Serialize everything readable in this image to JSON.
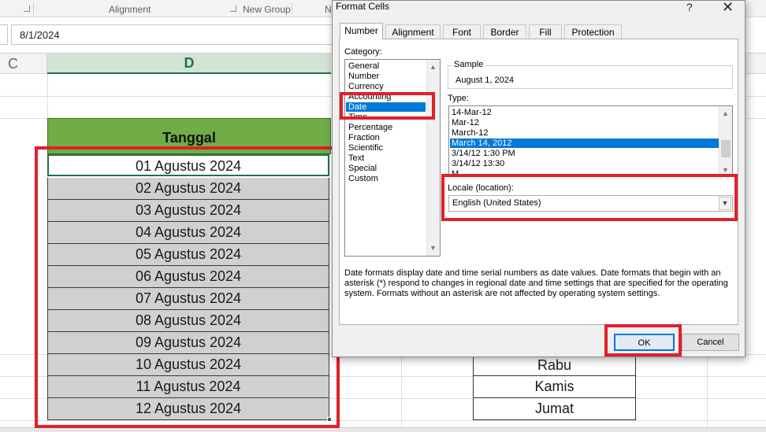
{
  "ribbon": {
    "groups": [
      "Alignment",
      "New Group",
      "N"
    ]
  },
  "formula_bar": {
    "value": "8/1/2024"
  },
  "sheet": {
    "col_c": "C",
    "col_d": "D",
    "header": "Tanggal",
    "dates": [
      "01 Agustus 2024",
      "02 Agustus 2024",
      "03 Agustus 2024",
      "04 Agustus 2024",
      "05 Agustus 2024",
      "06 Agustus 2024",
      "07 Agustus 2024",
      "08 Agustus 2024",
      "09 Agustus 2024",
      "10 Agustus 2024",
      "11 Agustus 2024",
      "12 Agustus 2024"
    ],
    "days": [
      "Rabu",
      "Kamis",
      "Jumat"
    ]
  },
  "dialog": {
    "title": "Format Cells",
    "help": "?",
    "close": "✕",
    "tabs": [
      "Number",
      "Alignment",
      "Font",
      "Border",
      "Fill",
      "Protection"
    ],
    "active_tab": "Number",
    "category_label": "Category:",
    "categories": [
      "General",
      "Number",
      "Currency",
      "Accounting",
      "Date",
      "Time",
      "Percentage",
      "Fraction",
      "Scientific",
      "Text",
      "Special",
      "Custom"
    ],
    "selected_category": "Date",
    "sample_label": "Sample",
    "sample_value": "August 1, 2024",
    "type_label": "Type:",
    "types": [
      "14-Mar-12",
      "Mar-12",
      "March-12",
      "March 14, 2012",
      "3/14/12 1:30 PM",
      "3/14/12 13:30",
      "M"
    ],
    "selected_type": "March 14, 2012",
    "locale_label": "Locale (location):",
    "locale_value": "English (United States)",
    "description": "Date formats display date and time serial numbers as date values.  Date formats that begin with an asterisk (*) respond to changes in regional date and time settings that are specified for the operating system. Formats without an asterisk are not affected by operating system settings.",
    "ok_label": "OK",
    "cancel_label": "Cancel"
  },
  "colors": {
    "excel_green": "#217346",
    "header_fill": "#70ad47",
    "cell_fill": "#d0d0d0",
    "highlight_red": "#e0202a",
    "selection_blue": "#0078d7"
  }
}
